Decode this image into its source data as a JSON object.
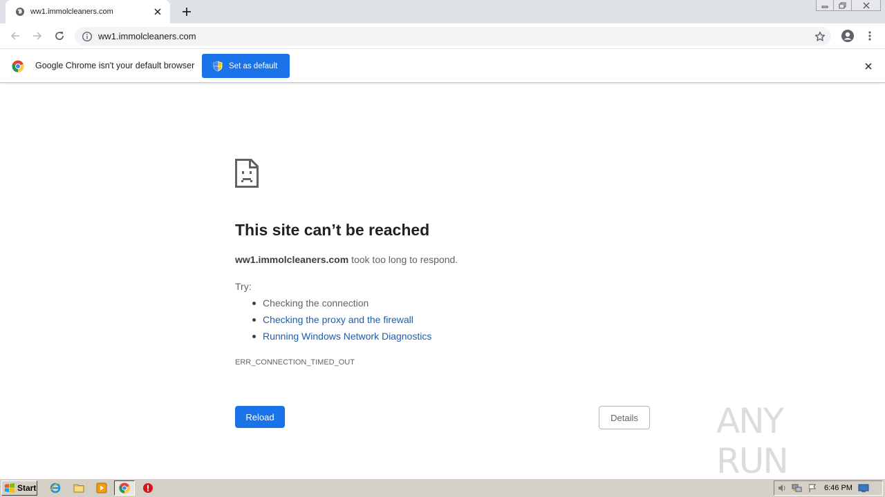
{
  "browser": {
    "tab": {
      "title": "ww1.immolcleaners.com"
    },
    "address_bar": {
      "url": "ww1.immolcleaners.com"
    }
  },
  "infobar": {
    "message": "Google Chrome isn't your default browser",
    "set_default_label": "Set as default"
  },
  "error_page": {
    "title": "This site can’t be reached",
    "host": "ww1.immolcleaners.com",
    "summary_suffix": " took too long to respond.",
    "try_label": "Try:",
    "suggestions": [
      {
        "text": "Checking the connection"
      },
      {
        "text": "Checking the proxy and the firewall"
      },
      {
        "text": "Running Windows Network Diagnostics"
      }
    ],
    "error_code": "ERR_CONNECTION_TIMED_OUT",
    "reload_label": "Reload",
    "details_label": "Details"
  },
  "watermark": {
    "text": "ANY RUN"
  },
  "taskbar": {
    "start_label": "Start",
    "clock": "6:46 PM"
  },
  "colors": {
    "accent": "#1a73e8",
    "link": "#1a5ead",
    "tabstrip": "#dee1e6",
    "taskbar": "#d4d0c8"
  },
  "icons": [
    "globe-icon",
    "close-icon",
    "plus-icon",
    "back-icon",
    "forward-icon",
    "reload-icon",
    "info-icon",
    "star-icon",
    "profile-icon",
    "menu-icon",
    "chrome-logo-icon",
    "shield-icon",
    "sad-page-icon",
    "ie-icon",
    "folder-icon",
    "media-player-icon",
    "chrome-icon",
    "stop-icon",
    "speaker-icon",
    "network-icon",
    "flag-icon",
    "desktop-icon"
  ]
}
